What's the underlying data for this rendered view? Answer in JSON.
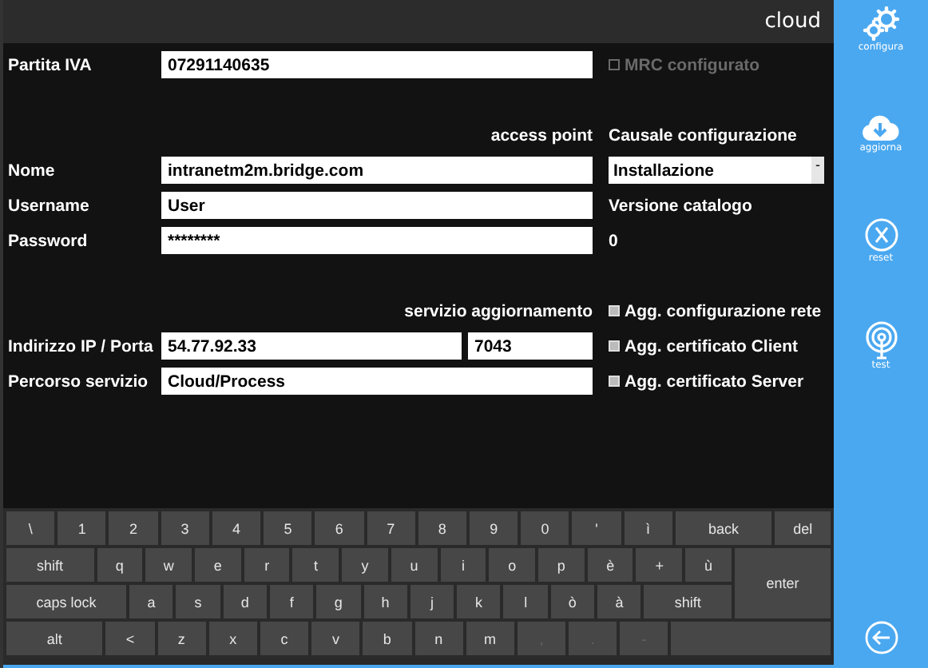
{
  "header": {
    "title": "cloud"
  },
  "partita_iva": {
    "label": "Partita IVA",
    "value": "07291140635"
  },
  "mrc": {
    "label": "MRC configurato",
    "checked": false,
    "disabled": true
  },
  "access_point": {
    "heading": "access point",
    "fields": [
      {
        "label": "Nome",
        "value": "intranetm2m.bridge.com"
      },
      {
        "label": "Username",
        "value": "User"
      },
      {
        "label": "Password",
        "value": "********"
      }
    ]
  },
  "causale": {
    "label": "Causale configurazione",
    "value": "Installazione",
    "arrow": "-"
  },
  "versione": {
    "label": "Versione catalogo",
    "value": "0"
  },
  "servizio": {
    "heading": "servizio aggiornamento",
    "ip_label": "Indirizzo IP / Porta",
    "ip": "54.77.92.33",
    "port": "7043",
    "path_label": "Percorso servizio",
    "path": "Cloud/Process"
  },
  "options": [
    {
      "label": "Agg. configurazione rete",
      "checked": true
    },
    {
      "label": "Agg. certificato Client",
      "checked": true
    },
    {
      "label": "Agg. certificato Server",
      "checked": true
    }
  ],
  "sidebar": [
    {
      "kind": "gear",
      "label": "configura"
    },
    {
      "kind": "cloud",
      "label": "aggiorna"
    },
    {
      "kind": "reset",
      "label": "reset"
    },
    {
      "kind": "test",
      "label": "test"
    }
  ],
  "keyboard": {
    "row1": [
      {
        "kind": "char",
        "label": "\\"
      },
      {
        "kind": "char",
        "label": "1"
      },
      {
        "kind": "char",
        "label": "2"
      },
      {
        "kind": "char",
        "label": "3"
      },
      {
        "kind": "char",
        "label": "4"
      },
      {
        "kind": "char",
        "label": "5"
      },
      {
        "kind": "char",
        "label": "6"
      },
      {
        "kind": "char",
        "label": "7"
      },
      {
        "kind": "char",
        "label": "8"
      },
      {
        "kind": "char",
        "label": "9"
      },
      {
        "kind": "char",
        "label": "0"
      },
      {
        "kind": "char",
        "label": "'"
      },
      {
        "kind": "char",
        "label": "ì"
      },
      {
        "kind": "back",
        "label": "back"
      },
      {
        "kind": "del",
        "label": "del"
      }
    ],
    "row2": [
      {
        "kind": "shift",
        "label": "shift"
      },
      {
        "kind": "char",
        "label": "q"
      },
      {
        "kind": "char",
        "label": "w"
      },
      {
        "kind": "char",
        "label": "e"
      },
      {
        "kind": "char",
        "label": "r"
      },
      {
        "kind": "char",
        "label": "t"
      },
      {
        "kind": "char",
        "label": "y"
      },
      {
        "kind": "char",
        "label": "u"
      },
      {
        "kind": "char",
        "label": "i"
      },
      {
        "kind": "char",
        "label": "o"
      },
      {
        "kind": "char",
        "label": "p"
      },
      {
        "kind": "char",
        "label": "è"
      },
      {
        "kind": "char",
        "label": "+"
      },
      {
        "kind": "char",
        "label": "ù"
      }
    ],
    "row3": [
      {
        "kind": "caps",
        "label": "caps lock"
      },
      {
        "kind": "char",
        "label": "a"
      },
      {
        "kind": "char",
        "label": "s"
      },
      {
        "kind": "char",
        "label": "d"
      },
      {
        "kind": "char",
        "label": "f"
      },
      {
        "kind": "char",
        "label": "g"
      },
      {
        "kind": "char",
        "label": "h"
      },
      {
        "kind": "char",
        "label": "j"
      },
      {
        "kind": "char",
        "label": "k"
      },
      {
        "kind": "char",
        "label": "l"
      },
      {
        "kind": "char",
        "label": "ò"
      },
      {
        "kind": "char",
        "label": "à"
      },
      {
        "kind": "shift2",
        "label": "shift"
      }
    ],
    "enter": {
      "label": "enter"
    },
    "row4": [
      {
        "kind": "alt",
        "label": "alt"
      },
      {
        "kind": "char",
        "label": "<"
      },
      {
        "kind": "char",
        "label": "z"
      },
      {
        "kind": "char",
        "label": "x"
      },
      {
        "kind": "char",
        "label": "c"
      },
      {
        "kind": "char",
        "label": "v"
      },
      {
        "kind": "char",
        "label": "b"
      },
      {
        "kind": "char",
        "label": "n"
      },
      {
        "kind": "char",
        "label": "m"
      },
      {
        "kind": "char",
        "label": ",",
        "disabled": true
      },
      {
        "kind": "char",
        "label": ".",
        "disabled": true
      },
      {
        "kind": "char",
        "label": "-",
        "disabled": true
      },
      {
        "kind": "space"
      }
    ]
  }
}
